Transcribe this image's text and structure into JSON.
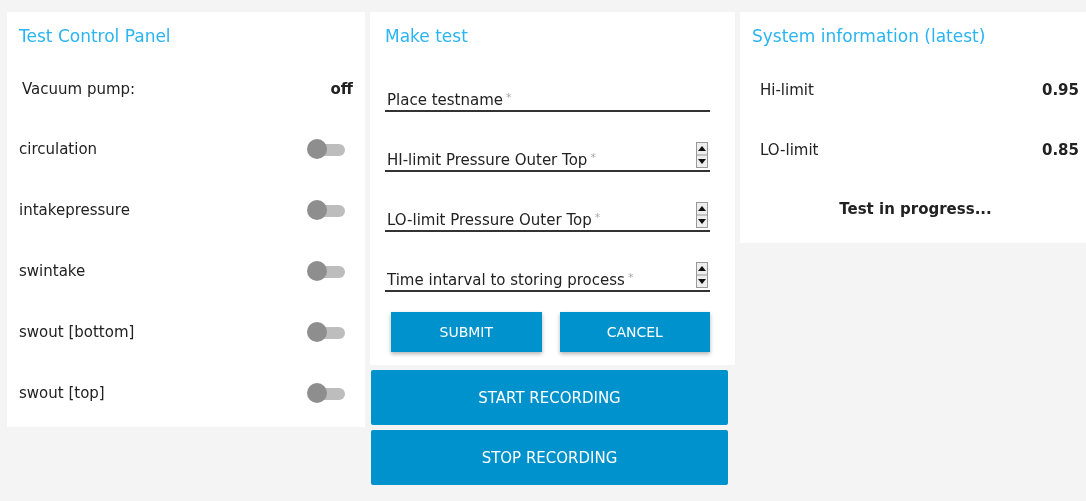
{
  "control_panel": {
    "title": "Test Control Panel",
    "status": {
      "label": "Vacuum pump:",
      "value": "off"
    },
    "switches": [
      {
        "label": "circulation",
        "on": false
      },
      {
        "label": "intakepressure",
        "on": false
      },
      {
        "label": "swintake",
        "on": false
      },
      {
        "label": "swout [bottom]",
        "on": false
      },
      {
        "label": "swout [top]",
        "on": false
      }
    ]
  },
  "make_test": {
    "title": "Make test",
    "fields": [
      {
        "kind": "text",
        "placeholder": "Place testname",
        "required_mark": "*"
      },
      {
        "kind": "number",
        "placeholder": "HI-limit Pressure Outer Top",
        "required_mark": "*"
      },
      {
        "kind": "number",
        "placeholder": "LO-limit Pressure Outer Top",
        "required_mark": "*"
      },
      {
        "kind": "number",
        "placeholder": "Time intarval to storing process",
        "required_mark": "*"
      }
    ],
    "buttons": [
      "SUBMIT",
      "CANCEL"
    ],
    "actions": [
      "START RECORDING",
      "STOP RECORDING"
    ]
  },
  "system_info": {
    "title": "System information (latest)",
    "rows": [
      {
        "label": "Hi-limit",
        "value": "0.95"
      },
      {
        "label": "LO-limit",
        "value": "0.85"
      }
    ],
    "status": "Test in progress..."
  }
}
